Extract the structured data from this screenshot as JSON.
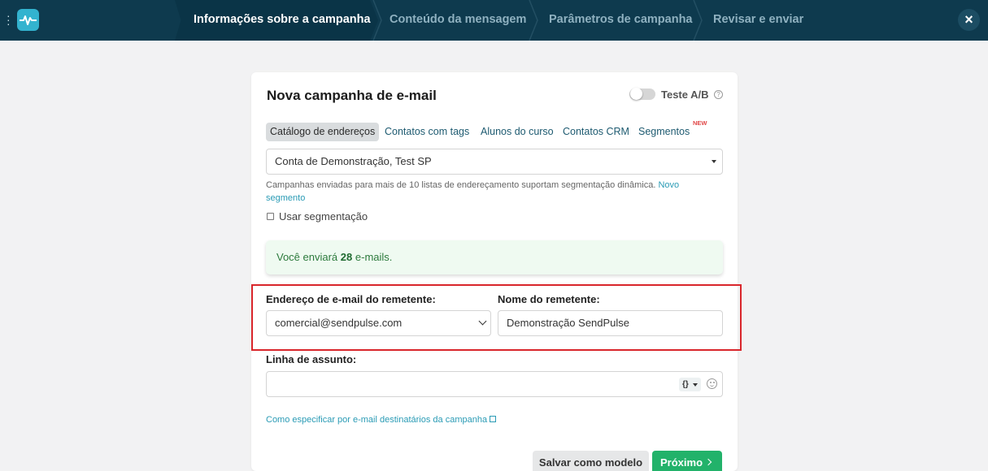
{
  "topbar": {
    "steps": [
      {
        "label": "Informações sobre a campanha",
        "active": true
      },
      {
        "label": "Conteúdo da mensagem",
        "active": false
      },
      {
        "label": "Parâmetros de campanha",
        "active": false
      },
      {
        "label": "Revisar e enviar",
        "active": false
      }
    ],
    "close_icon": "×"
  },
  "card": {
    "title": "Nova campanha de e-mail",
    "ab_test_label": "Teste A/B",
    "help_icon": "?",
    "tabs": [
      {
        "label": "Catálogo de endereços",
        "active": true
      },
      {
        "label": "Contatos com tags"
      },
      {
        "label": "Alunos do curso"
      },
      {
        "label": "Contatos CRM"
      },
      {
        "label": "Segmentos",
        "badge": "NEW"
      }
    ],
    "address_book_value": "Conta de Demonstração, Test SP",
    "hint_text": "Campanhas enviadas para mais de 10 listas de endereçamento suportam segmentação dinâmica.",
    "hint_link": "Novo segmento",
    "segmentation_label": "Usar segmentação",
    "notice_prefix": "Você enviará",
    "notice_count": "28",
    "notice_suffix": "e-mails.",
    "sender_email_label": "Endereço de e-mail do remetente:",
    "sender_email_value": "comercial@sendpulse.com",
    "sender_name_label": "Nome do remetente:",
    "sender_name_value": "Demonstração SendPulse",
    "subject_label": "Linha de assunto:",
    "subject_value": "",
    "vars_button": "{}",
    "recipients_link": "Como especificar por e-mail destinatários da campanha",
    "save_template_button": "Salvar como modelo",
    "next_button": "Próximo"
  },
  "colors": {
    "topbar": "#0e3a4e",
    "accent_green": "#22b26a",
    "link": "#2a9bb5",
    "highlight": "#d9262b"
  }
}
